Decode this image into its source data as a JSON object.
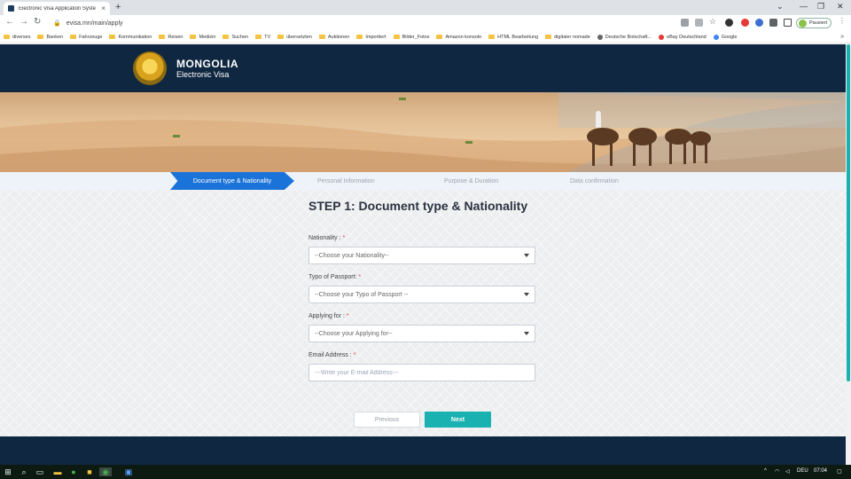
{
  "browser": {
    "tab_title": "Electronic Visa Application Syste",
    "tab_close": "×",
    "new_tab": "+",
    "url": "evisa.mn/main/apply",
    "profile_label": "Pausiert",
    "window_controls": [
      "⌄",
      "—",
      "❐",
      "✕"
    ],
    "icons": [
      "back-icon",
      "forward-icon",
      "reload-icon",
      "lock-icon",
      "translate-icon",
      "share-icon",
      "star-icon",
      "extension-icon",
      "menu-icon"
    ]
  },
  "bookmarks": [
    {
      "label": "diverses",
      "type": "folder"
    },
    {
      "label": "Banken",
      "type": "folder"
    },
    {
      "label": "Fahrzeuge",
      "type": "folder"
    },
    {
      "label": "Kommunikation",
      "type": "folder"
    },
    {
      "label": "Reisen",
      "type": "folder"
    },
    {
      "label": "Medizin",
      "type": "folder"
    },
    {
      "label": "Suchen",
      "type": "folder"
    },
    {
      "label": "TV",
      "type": "folder"
    },
    {
      "label": "übersetzten",
      "type": "folder"
    },
    {
      "label": "Auktionen",
      "type": "folder"
    },
    {
      "label": "Importiert",
      "type": "folder"
    },
    {
      "label": "Bilder_Fotos",
      "type": "folder"
    },
    {
      "label": "Amazon konsole",
      "type": "folder"
    },
    {
      "label": "HTML Bearbeitung",
      "type": "folder"
    },
    {
      "label": "digitaler nomade",
      "type": "folder"
    },
    {
      "label": "Deutsche Botschaft...",
      "type": "link"
    },
    {
      "label": "eBay Deutschland",
      "type": "link"
    },
    {
      "label": "Google",
      "type": "link"
    }
  ],
  "site": {
    "brand_title": "MONGOLIA",
    "brand_subtitle": "Electronic Visa",
    "steps": [
      {
        "label": "Document type & Nationality",
        "active": true
      },
      {
        "label": "Personal Information",
        "active": false
      },
      {
        "label": "Purpose & Duration",
        "active": false
      },
      {
        "label": "Data confirmation",
        "active": false
      }
    ],
    "step_title": "STEP 1: Document type & Nationality",
    "fields": {
      "nationality": {
        "label": "Nationality :",
        "value": "--Choose your Nationality--"
      },
      "passport": {
        "label": "Typo of Passport:",
        "value": "--Choose your Typo of Passport --"
      },
      "applying": {
        "label": "Applying for :",
        "value": "--Choose your Applying for--"
      },
      "email": {
        "label": "Email Address :",
        "placeholder": "---Write your E-mail Address---"
      }
    },
    "required_mark": "*",
    "buttons": {
      "previous": "Previous",
      "next": "Next"
    },
    "colors": {
      "header": "#0f2740",
      "active_step": "#1a73d9",
      "next_button": "#1ab1b1"
    }
  },
  "taskbar": {
    "language": "DEU",
    "time": "07:04",
    "tray_arrow": "^"
  }
}
